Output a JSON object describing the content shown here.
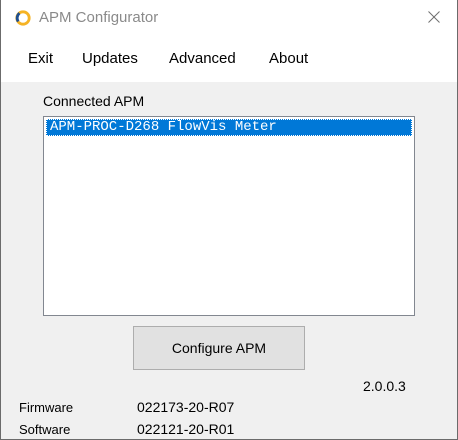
{
  "window": {
    "title": "APM Configurator"
  },
  "icons": {
    "app": "apm-logo-icon",
    "close": "close-icon"
  },
  "menu": {
    "items": [
      "Exit",
      "Updates",
      "Advanced",
      "About"
    ]
  },
  "connected": {
    "label": "Connected APM",
    "items": [
      "APM-PROC-D268 FlowVis Meter"
    ],
    "selected_index": 0
  },
  "actions": {
    "configure_label": "Configure APM"
  },
  "version": "2.0.0.3",
  "info": {
    "firmware_label": "Firmware",
    "firmware_value": "022173-20-R07",
    "software_label": "Software",
    "software_value": "022121-20-R01"
  },
  "colors": {
    "selection": "#0078d7",
    "logo_ring": "#f5b324",
    "logo_accent": "#1f4f8f",
    "window_bg": "#f0f0f0",
    "title_text": "#8a8a8a"
  }
}
